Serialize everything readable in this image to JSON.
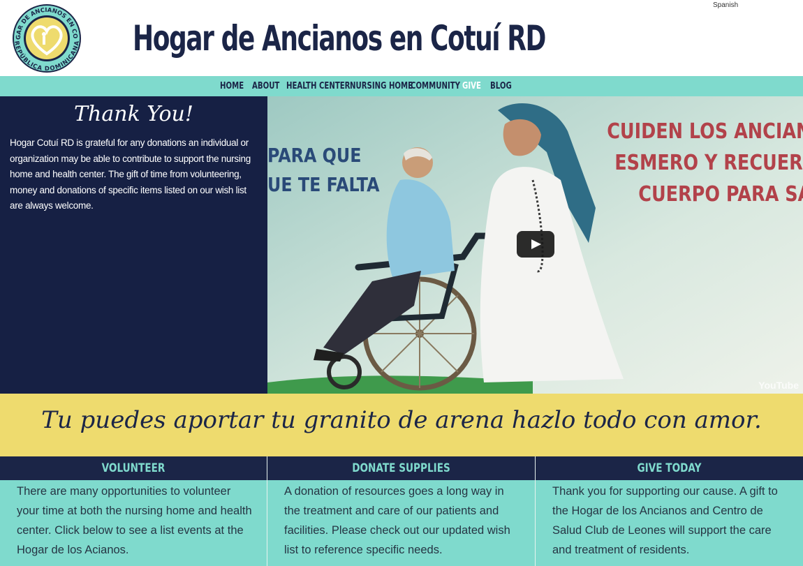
{
  "header": {
    "site_title": "Hogar de Ancianos en Cotuí RD",
    "language_link": "Spanish",
    "logo": {
      "top_arc": "HOGAR DE ANCIANOS EN COTUÍ",
      "bottom_arc": "REPÚBLICA DOMINICANA"
    }
  },
  "nav": {
    "items": [
      {
        "label": "HOME"
      },
      {
        "label": "ABOUT"
      },
      {
        "label": "HEALTH CENTER"
      },
      {
        "label": "NURSING HOME"
      },
      {
        "label": "COMMUNITY"
      },
      {
        "label": "GIVE"
      },
      {
        "label": "BLOG"
      }
    ],
    "active": "GIVE"
  },
  "thanks": {
    "heading": "Thank You!",
    "body": "Hogar Cotuí RD is grateful for any donations an individual or organization may be able to contribute to support the nursing home and health center. The gift of time from volunteering, money and donations of specific items listed on our wish list are always welcome."
  },
  "video": {
    "mural_left_1": "PARA QUE",
    "mural_left_2": "UE TE FALTA",
    "mural_right_1": "CUIDEN LOS ANCIANOS",
    "mural_right_2": "ESMERO Y RECUERDEN",
    "mural_right_3": "CUERPO PARA SALV",
    "provider": "YouTube"
  },
  "banner": {
    "text": "Tu puedes aportar tu granito de arena hazlo todo con amor."
  },
  "columns": [
    {
      "title": "VOLUNTEER",
      "text": "There are many opportunities to volunteer your time at both the nursing home and health center. Click below to see a list events at the Hogar de los Acianos."
    },
    {
      "title": "DONATE SUPPLIES",
      "text": "A donation of resources goes a long way in the treatment and care of our patients and facilities. Please check out our updated wish list to reference specific needs."
    },
    {
      "title": "GIVE TODAY",
      "text": "Thank you for supporting our cause. A gift to the Hogar de los Ancianos and Centro de Salud Club de Leones will support the care and treatment of residents."
    }
  ],
  "colors": {
    "navy": "#1b2547",
    "teal": "#7fdacd",
    "yellow": "#eedb6e"
  }
}
